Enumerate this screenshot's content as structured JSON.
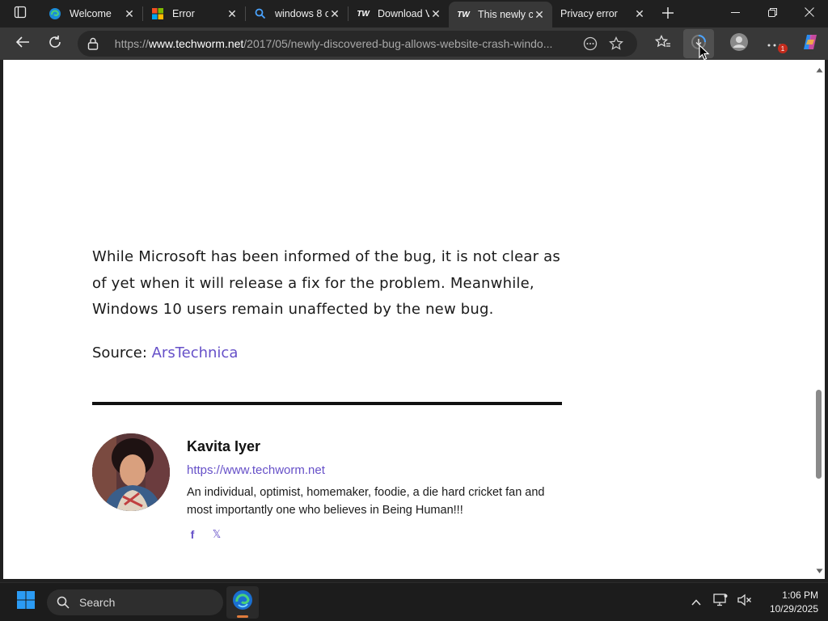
{
  "browser": {
    "tabs": [
      {
        "title": "Welcome",
        "favicon": "edge-icon",
        "active": false
      },
      {
        "title": "Error",
        "favicon": "microsoft-icon",
        "active": false
      },
      {
        "title": "windows 8 c",
        "favicon": "search-icon",
        "active": false
      },
      {
        "title": "Download V",
        "favicon": "techworm-icon",
        "active": false
      },
      {
        "title": "This newly c",
        "favicon": "techworm-icon",
        "active": true
      },
      {
        "title": "Privacy error",
        "favicon": "none",
        "active": false
      }
    ],
    "favicon_text": "TW",
    "url_prefix": "https://",
    "url_host": "www.techworm.net",
    "url_path": "/2017/05/newly-discovered-bug-allows-website-crash-windo...",
    "notification_count": "1"
  },
  "article": {
    "paragraph": "While Microsoft has been informed of the bug, it is not clear as of yet when it will release a fix for the problem. Meanwhile, Windows 10 users remain unaffected by the new bug.",
    "source_label": "Source: ",
    "source_link": "ArsTechnica"
  },
  "author": {
    "name": "Kavita Iyer",
    "url": "https://www.techworm.net",
    "bio": "An individual, optimist, homemaker, foodie, a die hard cricket fan and most importantly one who believes in Being Human!!!",
    "socials": [
      {
        "name": "facebook-icon",
        "glyph": "f"
      },
      {
        "name": "x-icon",
        "glyph": "𝕏"
      }
    ]
  },
  "taskbar": {
    "search_label": "Search",
    "time": "1:06 PM",
    "date": "10/29/2025"
  },
  "colors": {
    "link": "#6650c8",
    "edge_accent": "#e07b3c"
  }
}
